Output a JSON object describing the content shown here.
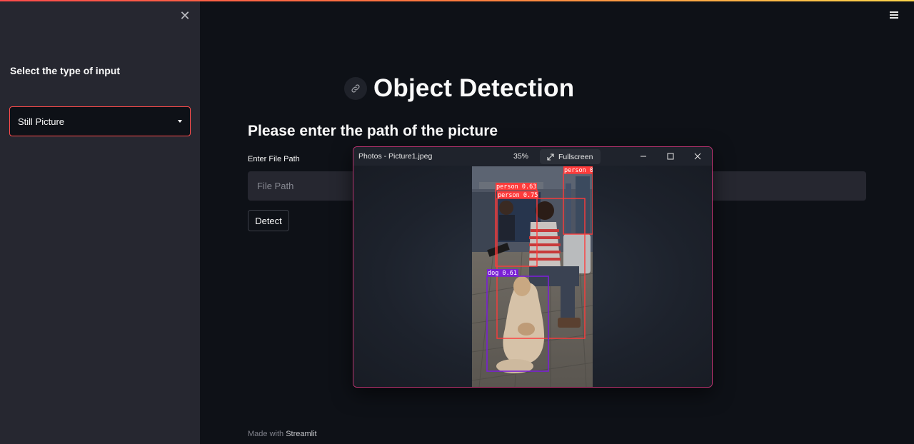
{
  "sidebar": {
    "heading": "Select the type of input",
    "select": {
      "value": "Still Picture"
    }
  },
  "main": {
    "title": "Object Detection",
    "subheading": "Please enter the path of the picture",
    "file_path": {
      "label": "Enter File Path",
      "placeholder": "File Path",
      "value": ""
    },
    "detect_label": "Detect",
    "footer_prefix": "Made with",
    "footer_brand": "Streamlit"
  },
  "photos_window": {
    "title": "Photos - Picture1.jpeg",
    "zoom": "35%",
    "fullscreen_label": "Fullscreen",
    "detections": [
      {
        "label": "person",
        "score": "0.63"
      },
      {
        "label": "person",
        "score": "0.75"
      },
      {
        "label": "person",
        "score": "0"
      },
      {
        "label": "dog",
        "score": "0.61"
      }
    ]
  },
  "colors": {
    "accent": "#ff4b4b",
    "background": "#0e1117",
    "sidebar": "#262730",
    "person_box": "#ff3b3b",
    "dog_box": "#7a1fd6",
    "window_border": "#b8336f"
  },
  "icons": [
    "close-icon",
    "menu-icon",
    "link-icon",
    "chevron-down-icon",
    "expand-icon",
    "minimize-icon",
    "maximize-icon",
    "window-close-icon"
  ]
}
